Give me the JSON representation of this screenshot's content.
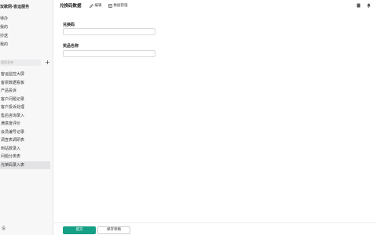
{
  "sidebar": {
    "app_title": "双歌网-客运服务",
    "nav": [
      "待办",
      "我的",
      "抄送",
      "我的"
    ],
    "search_placeholder": "搜索表单",
    "forms": [
      "客运监控大屏",
      "客票数据看板",
      "产品投诉",
      "客户问题记录",
      "客户投诉处理",
      "售后咨询录入",
      "满意度评价",
      "会员编号记录",
      "调查表调研表",
      "到站数录入",
      "问题分类表",
      "光荣码录入表"
    ],
    "active_form_index": 11,
    "footer": "设"
  },
  "topbar": {
    "title": "兑换码数据",
    "edit_label": "编辑",
    "data_manage_label": "数据管理"
  },
  "form": {
    "field1_label": "兑换码",
    "field1_value": "",
    "field2_label": "奖品名称",
    "field2_value": ""
  },
  "footer": {
    "submit_label": "提交",
    "draft_label": "保存草稿"
  },
  "colors": {
    "primary": "#16a085",
    "sidebar_bg": "#f7f7f8",
    "active_item_bg": "#e3e3e6"
  }
}
